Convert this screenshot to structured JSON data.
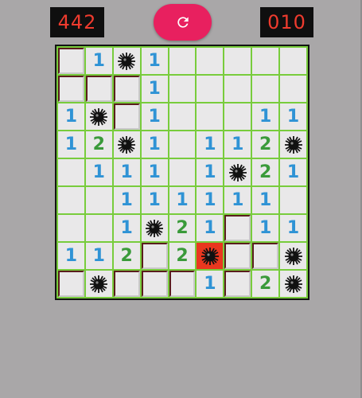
{
  "counters": {
    "mines_left": "442",
    "timer": "010"
  },
  "reset_button": {
    "icon": "refresh-icon",
    "color": "#e8205f"
  },
  "colors": {
    "background": "#a9a7a8",
    "grid_lines": "#78cc3c",
    "cell": "#e9e8e9",
    "number_1": "#2f93d5",
    "number_2": "#3a9a3a",
    "exploded": "#e9371f",
    "counter_text": "#ee3b2e"
  },
  "board": {
    "rows": 9,
    "cols": 9,
    "legend": "H = unrevealed, E = revealed empty, M = mine, X = exploded mine, digit = adjacent count",
    "cells": [
      [
        "H",
        "1",
        "M",
        "1",
        "E",
        "E",
        "E",
        "E",
        "E"
      ],
      [
        "H",
        "H",
        "H",
        "1",
        "E",
        "E",
        "E",
        "E",
        "E"
      ],
      [
        "1",
        "M",
        "H",
        "1",
        "E",
        "E",
        "E",
        "1",
        "1"
      ],
      [
        "1",
        "2",
        "M",
        "1",
        "E",
        "1",
        "1",
        "2",
        "M"
      ],
      [
        "E",
        "1",
        "1",
        "1",
        "E",
        "1",
        "M",
        "2",
        "1"
      ],
      [
        "E",
        "E",
        "1",
        "1",
        "1",
        "1",
        "1",
        "1",
        "E"
      ],
      [
        "E",
        "E",
        "1",
        "M",
        "2",
        "1",
        "H",
        "1",
        "1"
      ],
      [
        "1",
        "1",
        "2",
        "H",
        "2",
        "X",
        "H",
        "H",
        "M"
      ],
      [
        "H",
        "M",
        "H",
        "H",
        "H",
        "1",
        "H",
        "2",
        "M"
      ]
    ]
  }
}
